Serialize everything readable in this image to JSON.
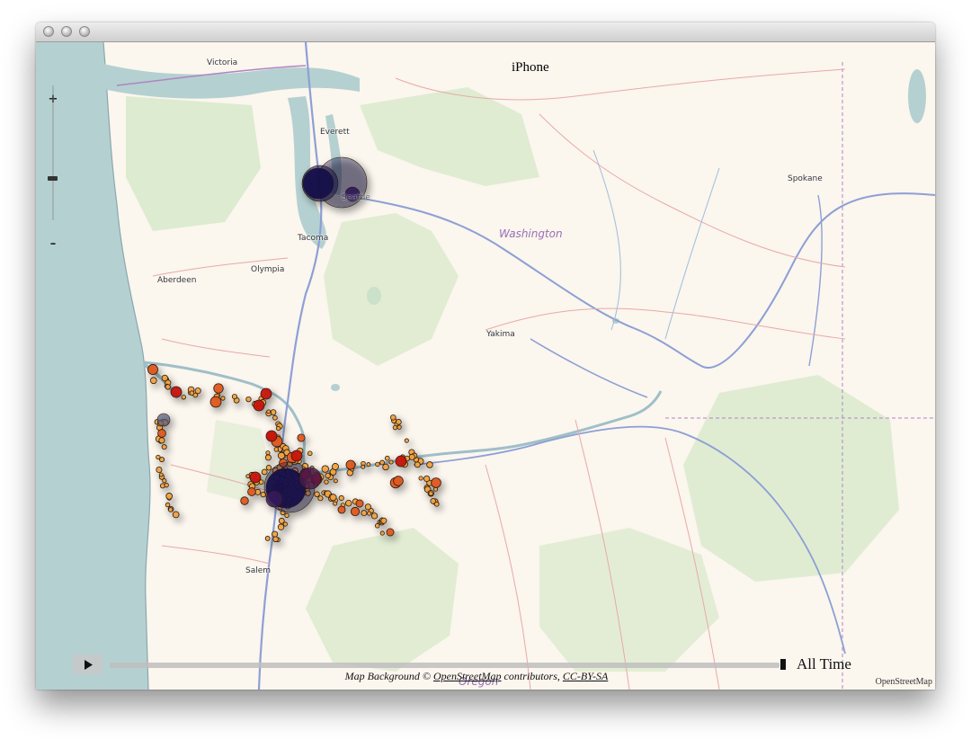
{
  "window": {
    "title": ""
  },
  "map": {
    "device_title": "iPhone",
    "zoom": {
      "plus": "+",
      "minus": "–"
    },
    "places": [
      {
        "name": "Victoria",
        "key": "victoria"
      },
      {
        "name": "Everett",
        "key": "everett"
      },
      {
        "name": "Seattle",
        "key": "seattle"
      },
      {
        "name": "Tacoma",
        "key": "tacoma"
      },
      {
        "name": "Olympia",
        "key": "olympia"
      },
      {
        "name": "Aberdeen",
        "key": "aberdeen"
      },
      {
        "name": "Spokane",
        "key": "spokane"
      },
      {
        "name": "Yakima",
        "key": "yakima"
      },
      {
        "name": "Salem",
        "key": "salem"
      }
    ],
    "states": [
      {
        "name": "Washington",
        "key": "washington"
      },
      {
        "name": "Oregon",
        "key": "oregon"
      }
    ],
    "colors": {
      "water": "#b5d0d0",
      "land": "#fbf6ee",
      "forest": "#d6e8c8",
      "highway": "#8d9fd5",
      "border": "#b084c4",
      "point_small": "#f1a340",
      "point_medium": "#e0581d",
      "point_large": "#c8140c",
      "cluster": "#16104a"
    }
  },
  "timeline": {
    "play_icon": "play-icon",
    "label": "All Time"
  },
  "attribution": {
    "prefix": "Map Background ©",
    "osm_link": "OpenStreetMap",
    "middle": "contributors,",
    "license_link": "CC-BY-SA",
    "corner": "OpenStreetMap"
  }
}
